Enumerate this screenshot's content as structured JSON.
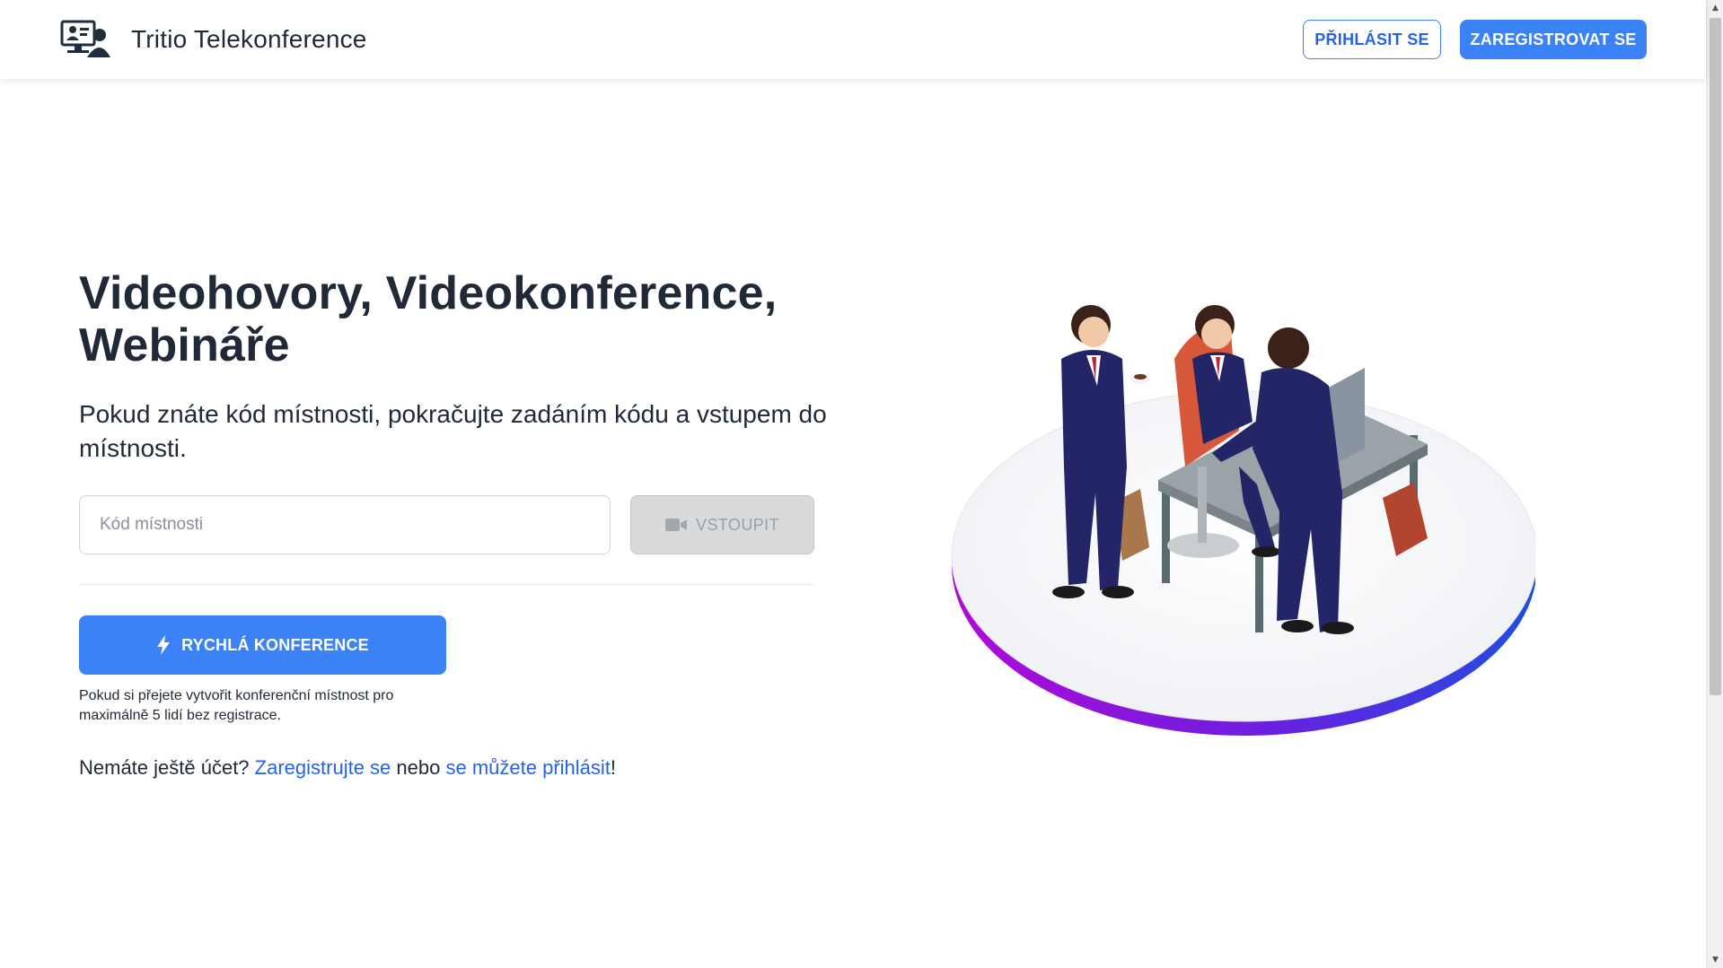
{
  "header": {
    "app_name": "Tritio Telekonference",
    "login_label": "PŘIHLÁSIT SE",
    "register_label": "ZAREGISTROVAT SE"
  },
  "hero": {
    "title_line1": "Videohovory, Videokonference,",
    "title_line2": "Webináře",
    "subtitle": "Pokud znáte kód místnosti, pokračujte zadáním kódu a vstupem do místnosti."
  },
  "join": {
    "room_placeholder": "Kód místnosti",
    "room_value": "",
    "join_label": "VSTOUPIT",
    "join_icon": "video-camera-icon"
  },
  "quick": {
    "button_label": "RYCHLÁ KONFERENCE",
    "button_icon": "lightning-bolt-icon",
    "note": "Pokud si přejete vytvořit konferenční místnost pro maximálně 5 lidí bez registrace."
  },
  "account": {
    "prefix": "Nemáte ještě účet?",
    "register_link": "Zaregistrujte se",
    "middle": "nebo",
    "login_link": "se můžete přihlásit",
    "suffix": "!"
  },
  "colors": {
    "primary": "#3b82f6",
    "text": "#1f2937",
    "disabled_bg": "#d9dadc",
    "ring_gradient_start": "#b00ad8",
    "ring_gradient_end": "#1d4ee0"
  }
}
